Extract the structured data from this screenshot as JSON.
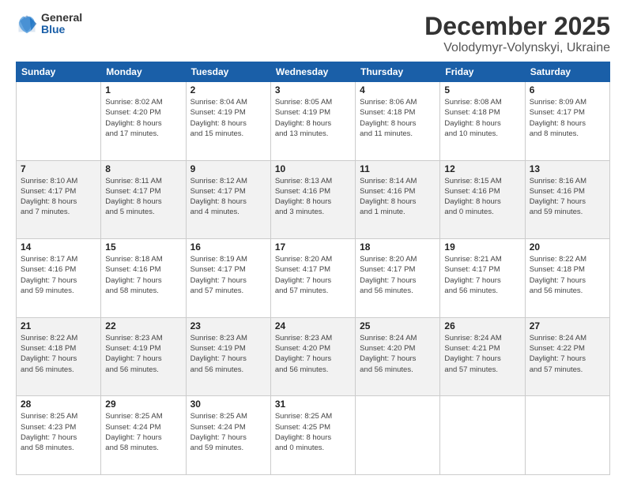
{
  "logo": {
    "general": "General",
    "blue": "Blue"
  },
  "title": "December 2025",
  "location": "Volodymyr-Volynskyi, Ukraine",
  "weekdays": [
    "Sunday",
    "Monday",
    "Tuesday",
    "Wednesday",
    "Thursday",
    "Friday",
    "Saturday"
  ],
  "weeks": [
    [
      {
        "day": "",
        "info": ""
      },
      {
        "day": "1",
        "info": "Sunrise: 8:02 AM\nSunset: 4:20 PM\nDaylight: 8 hours\nand 17 minutes."
      },
      {
        "day": "2",
        "info": "Sunrise: 8:04 AM\nSunset: 4:19 PM\nDaylight: 8 hours\nand 15 minutes."
      },
      {
        "day": "3",
        "info": "Sunrise: 8:05 AM\nSunset: 4:19 PM\nDaylight: 8 hours\nand 13 minutes."
      },
      {
        "day": "4",
        "info": "Sunrise: 8:06 AM\nSunset: 4:18 PM\nDaylight: 8 hours\nand 11 minutes."
      },
      {
        "day": "5",
        "info": "Sunrise: 8:08 AM\nSunset: 4:18 PM\nDaylight: 8 hours\nand 10 minutes."
      },
      {
        "day": "6",
        "info": "Sunrise: 8:09 AM\nSunset: 4:17 PM\nDaylight: 8 hours\nand 8 minutes."
      }
    ],
    [
      {
        "day": "7",
        "info": "Sunrise: 8:10 AM\nSunset: 4:17 PM\nDaylight: 8 hours\nand 7 minutes."
      },
      {
        "day": "8",
        "info": "Sunrise: 8:11 AM\nSunset: 4:17 PM\nDaylight: 8 hours\nand 5 minutes."
      },
      {
        "day": "9",
        "info": "Sunrise: 8:12 AM\nSunset: 4:17 PM\nDaylight: 8 hours\nand 4 minutes."
      },
      {
        "day": "10",
        "info": "Sunrise: 8:13 AM\nSunset: 4:16 PM\nDaylight: 8 hours\nand 3 minutes."
      },
      {
        "day": "11",
        "info": "Sunrise: 8:14 AM\nSunset: 4:16 PM\nDaylight: 8 hours\nand 1 minute."
      },
      {
        "day": "12",
        "info": "Sunrise: 8:15 AM\nSunset: 4:16 PM\nDaylight: 8 hours\nand 0 minutes."
      },
      {
        "day": "13",
        "info": "Sunrise: 8:16 AM\nSunset: 4:16 PM\nDaylight: 7 hours\nand 59 minutes."
      }
    ],
    [
      {
        "day": "14",
        "info": "Sunrise: 8:17 AM\nSunset: 4:16 PM\nDaylight: 7 hours\nand 59 minutes."
      },
      {
        "day": "15",
        "info": "Sunrise: 8:18 AM\nSunset: 4:16 PM\nDaylight: 7 hours\nand 58 minutes."
      },
      {
        "day": "16",
        "info": "Sunrise: 8:19 AM\nSunset: 4:17 PM\nDaylight: 7 hours\nand 57 minutes."
      },
      {
        "day": "17",
        "info": "Sunrise: 8:20 AM\nSunset: 4:17 PM\nDaylight: 7 hours\nand 57 minutes."
      },
      {
        "day": "18",
        "info": "Sunrise: 8:20 AM\nSunset: 4:17 PM\nDaylight: 7 hours\nand 56 minutes."
      },
      {
        "day": "19",
        "info": "Sunrise: 8:21 AM\nSunset: 4:17 PM\nDaylight: 7 hours\nand 56 minutes."
      },
      {
        "day": "20",
        "info": "Sunrise: 8:22 AM\nSunset: 4:18 PM\nDaylight: 7 hours\nand 56 minutes."
      }
    ],
    [
      {
        "day": "21",
        "info": "Sunrise: 8:22 AM\nSunset: 4:18 PM\nDaylight: 7 hours\nand 56 minutes."
      },
      {
        "day": "22",
        "info": "Sunrise: 8:23 AM\nSunset: 4:19 PM\nDaylight: 7 hours\nand 56 minutes."
      },
      {
        "day": "23",
        "info": "Sunrise: 8:23 AM\nSunset: 4:19 PM\nDaylight: 7 hours\nand 56 minutes."
      },
      {
        "day": "24",
        "info": "Sunrise: 8:23 AM\nSunset: 4:20 PM\nDaylight: 7 hours\nand 56 minutes."
      },
      {
        "day": "25",
        "info": "Sunrise: 8:24 AM\nSunset: 4:20 PM\nDaylight: 7 hours\nand 56 minutes."
      },
      {
        "day": "26",
        "info": "Sunrise: 8:24 AM\nSunset: 4:21 PM\nDaylight: 7 hours\nand 57 minutes."
      },
      {
        "day": "27",
        "info": "Sunrise: 8:24 AM\nSunset: 4:22 PM\nDaylight: 7 hours\nand 57 minutes."
      }
    ],
    [
      {
        "day": "28",
        "info": "Sunrise: 8:25 AM\nSunset: 4:23 PM\nDaylight: 7 hours\nand 58 minutes."
      },
      {
        "day": "29",
        "info": "Sunrise: 8:25 AM\nSunset: 4:24 PM\nDaylight: 7 hours\nand 58 minutes."
      },
      {
        "day": "30",
        "info": "Sunrise: 8:25 AM\nSunset: 4:24 PM\nDaylight: 7 hours\nand 59 minutes."
      },
      {
        "day": "31",
        "info": "Sunrise: 8:25 AM\nSunset: 4:25 PM\nDaylight: 8 hours\nand 0 minutes."
      },
      {
        "day": "",
        "info": ""
      },
      {
        "day": "",
        "info": ""
      },
      {
        "day": "",
        "info": ""
      }
    ]
  ]
}
